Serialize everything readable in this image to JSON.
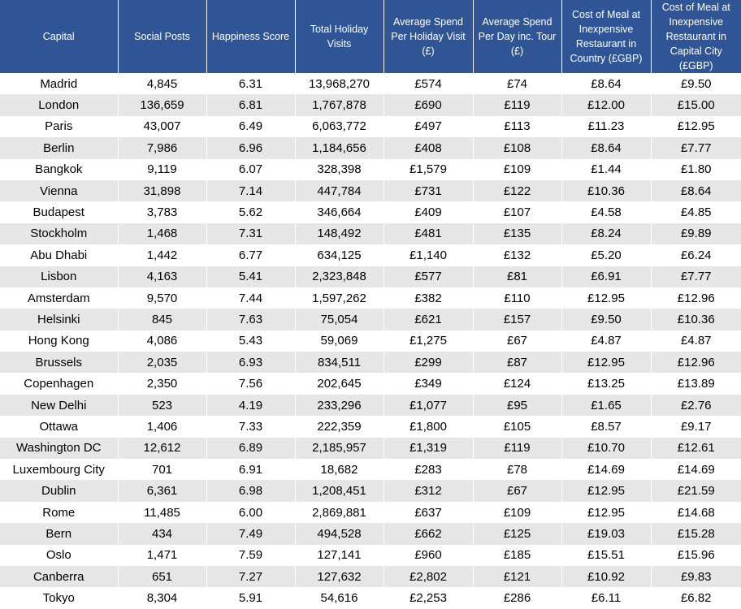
{
  "chart_data": {
    "type": "table",
    "columns": [
      "Capital",
      "Social Posts",
      "Happiness Score",
      "Total Holiday Visits",
      "Average Spend Per Holiday Visit (£)",
      "Average Spend Per Day inc. Tour (£)",
      "Cost of Meal at Inexpensive Restaurant in Country (£GBP)",
      "Cost of Meal at Inexpensive Restaurant in Capital City (£GBP)"
    ],
    "rows": [
      [
        "Madrid",
        "4,845",
        "6.31",
        "13,968,270",
        "£574",
        "£74",
        "£8.64",
        "£9.50"
      ],
      [
        "London",
        "136,659",
        "6.81",
        "1,767,878",
        "£690",
        "£119",
        "£12.00",
        "£15.00"
      ],
      [
        "Paris",
        "43,007",
        "6.49",
        "6,063,772",
        "£497",
        "£113",
        "£11.23",
        "£12.95"
      ],
      [
        "Berlin",
        "7,986",
        "6.96",
        "1,184,656",
        "£408",
        "£108",
        "£8.64",
        "£7.77"
      ],
      [
        "Bangkok",
        "9,119",
        "6.07",
        "328,398",
        "£1,579",
        "£109",
        "£1.44",
        "£1.80"
      ],
      [
        "Vienna",
        "31,898",
        "7.14",
        "447,784",
        "£731",
        "£122",
        "£10.36",
        "£8.64"
      ],
      [
        "Budapest",
        "3,783",
        "5.62",
        "346,664",
        "£409",
        "£107",
        "£4.58",
        "£4.85"
      ],
      [
        "Stockholm",
        "1,468",
        "7.31",
        "148,492",
        "£481",
        "£135",
        "£8.24",
        "£9.89"
      ],
      [
        "Abu Dhabi",
        "1,442",
        "6.77",
        "634,125",
        "£1,140",
        "£132",
        "£5.20",
        "£6.24"
      ],
      [
        "Lisbon",
        "4,163",
        "5.41",
        "2,323,848",
        "£577",
        "£81",
        "£6.91",
        "£7.77"
      ],
      [
        "Amsterdam",
        "9,570",
        "7.44",
        "1,597,262",
        "£382",
        "£110",
        "£12.95",
        "£12.96"
      ],
      [
        "Helsinki",
        "845",
        "7.63",
        "75,054",
        "£621",
        "£157",
        "£9.50",
        "£10.36"
      ],
      [
        "Hong Kong",
        "4,086",
        "5.43",
        "59,069",
        "£1,275",
        "£67",
        "£4.87",
        "£4.87"
      ],
      [
        "Brussels",
        "2,035",
        "6.93",
        "834,511",
        "£299",
        "£87",
        "£12.95",
        "£12.96"
      ],
      [
        "Copenhagen",
        "2,350",
        "7.56",
        "202,645",
        "£349",
        "£124",
        "£13.25",
        "£13.89"
      ],
      [
        "New Delhi",
        "523",
        "4.19",
        "233,296",
        "£1,077",
        "£95",
        "£1.65",
        "£2.76"
      ],
      [
        "Ottawa",
        "1,406",
        "7.33",
        "222,359",
        "£1,800",
        "£105",
        "£8.57",
        "£9.17"
      ],
      [
        "Washington DC",
        "12,612",
        "6.89",
        "2,185,957",
        "£1,319",
        "£119",
        "£10.70",
        "£12.61"
      ],
      [
        "Luxembourg City",
        "701",
        "6.91",
        "18,682",
        "£283",
        "£78",
        "£14.69",
        "£14.69"
      ],
      [
        "Dublin",
        "6,361",
        "6.98",
        "1,208,451",
        "£312",
        "£67",
        "£12.95",
        "£21.59"
      ],
      [
        "Rome",
        "11,485",
        "6.00",
        "2,869,881",
        "£637",
        "£109",
        "£12.95",
        "£14.68"
      ],
      [
        "Bern",
        "434",
        "7.49",
        "494,528",
        "£662",
        "£125",
        "£19.03",
        "£15.28"
      ],
      [
        "Oslo",
        "1,471",
        "7.59",
        "127,141",
        "£960",
        "£185",
        "£15.51",
        "£15.96"
      ],
      [
        "Canberra",
        "651",
        "7.27",
        "127,632",
        "£2,802",
        "£121",
        "£10.92",
        "£9.83"
      ],
      [
        "Tokyo",
        "8,304",
        "5.91",
        "54,616",
        "£2,253",
        "£286",
        "£6.11",
        "£6.82"
      ]
    ],
    "header_color": "#2f5597",
    "header_text_color": "#ffffff",
    "stripe_color": "#e6e6e6"
  }
}
